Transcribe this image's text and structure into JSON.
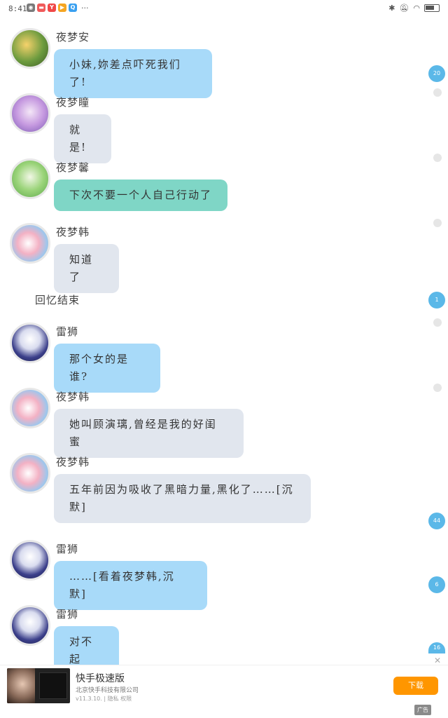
{
  "status_bar": {
    "time": "8:41",
    "more": "···",
    "app_icons": [
      {
        "icon": "wechat-icon",
        "color": "#7a7a7a",
        "glyph": "◉"
      },
      {
        "icon": "app-red-icon",
        "color": "#f05a5a",
        "glyph": "▬"
      },
      {
        "icon": "app-red-y-icon",
        "color": "#f04848",
        "glyph": "Y"
      },
      {
        "icon": "app-orange-icon",
        "color": "#f5a623",
        "glyph": "▶"
      },
      {
        "icon": "app-blue-icon",
        "color": "#3aa0f0",
        "glyph": "Q"
      }
    ],
    "battery_level": 0.6
  },
  "messages": [
    {
      "name": "夜梦安",
      "text": "小妹,妳差点吓死我们了!",
      "bubble_color": "#a8daf9"
    },
    {
      "name": "夜梦瞳",
      "text": "就是!",
      "bubble_color": "#e1e6ee"
    },
    {
      "name": "夜梦馨",
      "text": "下次不要一个人自己行动了",
      "bubble_color": "#7fd6c6"
    },
    {
      "name": "夜梦韩",
      "text": "知道了",
      "bubble_color": "#e1e6ee"
    },
    {
      "name": "雷狮",
      "text": "那个女的是谁?",
      "bubble_color": "#a8daf9"
    },
    {
      "name": "夜梦韩",
      "text": "她叫顾演璃,曾经是我的好闺蜜",
      "bubble_color": "#e1e6ee"
    },
    {
      "name": "夜梦韩",
      "text": "五年前因为吸收了黑暗力量,黑化了……[沉默]",
      "bubble_color": "#e1e6ee"
    },
    {
      "name": "雷狮",
      "text": "……[看着夜梦韩,沉默]",
      "bubble_color": "#a8daf9"
    },
    {
      "name": "雷狮",
      "text": "对不起",
      "bubble_color": "#a8daf9"
    }
  ],
  "narration": "回忆结束",
  "side_badges": [
    "20",
    "1",
    "44",
    "6",
    "16"
  ],
  "ad": {
    "title": "快手极速版",
    "company": "北京快手科技有限公司",
    "meta": "v11.3.10. | 隐私 权限",
    "button": "下载",
    "tag": "广告",
    "close": "✕"
  }
}
